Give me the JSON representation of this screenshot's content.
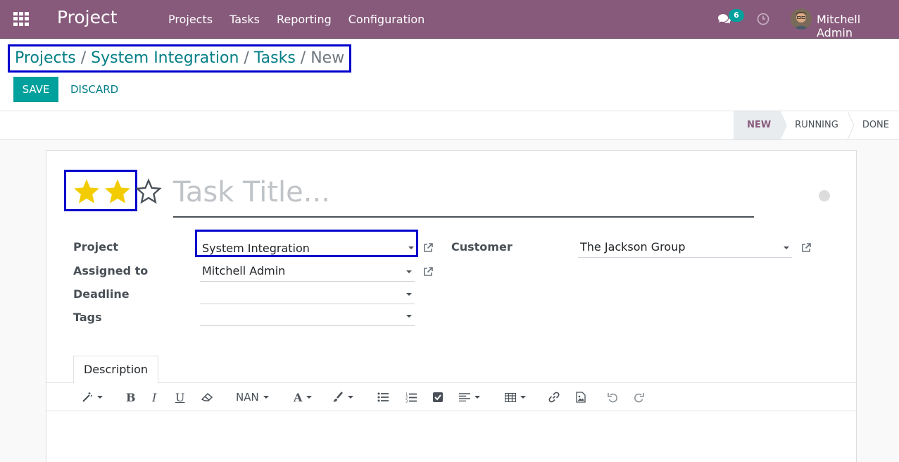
{
  "navbar": {
    "app_name": "Project",
    "menu": [
      "Projects",
      "Tasks",
      "Reporting",
      "Configuration"
    ],
    "messages_count": "6",
    "user_name": "Mitchell Admin",
    "bg_color": "#875a7b"
  },
  "breadcrumb": {
    "items": [
      "Projects",
      "System Integration",
      "Tasks"
    ],
    "separator": "/",
    "current": "New"
  },
  "buttons": {
    "save": "SAVE",
    "discard": "DISCARD"
  },
  "stages": [
    "NEW",
    "RUNNING",
    "DONE"
  ],
  "active_stage": "NEW",
  "task": {
    "priority_stars": 2,
    "max_stars": 3,
    "title_placeholder": "Task Title..."
  },
  "fields": {
    "project": {
      "label": "Project",
      "value": "System Integration"
    },
    "assigned_to": {
      "label": "Assigned to",
      "value": "Mitchell Admin"
    },
    "deadline": {
      "label": "Deadline",
      "value": ""
    },
    "tags": {
      "label": "Tags",
      "value": ""
    },
    "customer": {
      "label": "Customer",
      "value": "The Jackson Group"
    }
  },
  "notebook": {
    "tabs": [
      "Description"
    ]
  },
  "editor_toolbar": {
    "font_size": "NAN",
    "icons": [
      "magic-icon",
      "bold-icon",
      "italic-icon",
      "underline-icon",
      "eraser-icon",
      "font-size-dropdown",
      "font-color-icon",
      "paint-brush-icon",
      "bullet-list-icon",
      "numbered-list-icon",
      "checklist-icon",
      "align-icon",
      "table-icon",
      "link-icon",
      "image-icon",
      "undo-icon",
      "redo-icon"
    ]
  },
  "colors": {
    "primary": "#00a09d",
    "link": "#017e84",
    "star": "#f3cc00",
    "highlight_box": "#0000cc"
  }
}
